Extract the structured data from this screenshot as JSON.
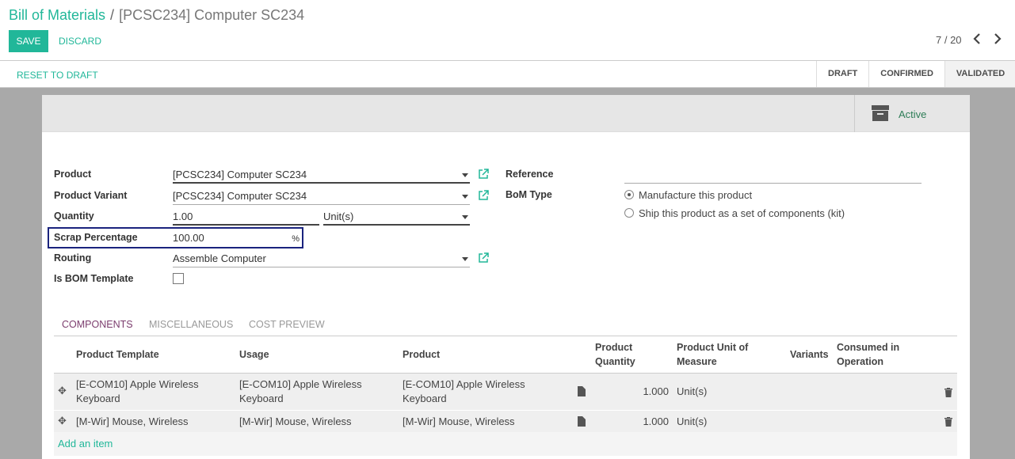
{
  "breadcrumb": {
    "parent": "Bill of Materials",
    "separator": "/",
    "current": "[PCSC234] Computer SC234"
  },
  "buttons": {
    "save": "SAVE",
    "discard": "DISCARD"
  },
  "pager": {
    "value": "7 / 20",
    "prev": "‹",
    "next": "›"
  },
  "statusbar": {
    "reset": "RESET TO DRAFT",
    "stages": [
      "DRAFT",
      "CONFIRMED",
      "VALIDATED"
    ],
    "current_stage": "VALIDATED"
  },
  "active_button": {
    "label": "Active",
    "icon": "archive-icon"
  },
  "form": {
    "product_label": "Product",
    "product_value": "[PCSC234] Computer SC234",
    "variant_label": "Product Variant",
    "variant_value": "[PCSC234] Computer SC234",
    "quantity_label": "Quantity",
    "quantity_value": "1.00",
    "uom_value": "Unit(s)",
    "scrap_label": "Scrap Percentage",
    "scrap_value": "100.00",
    "scrap_unit": "%",
    "routing_label": "Routing",
    "routing_value": "Assemble Computer",
    "template_label": "Is BOM Template",
    "reference_label": "Reference",
    "reference_value": "",
    "bom_type_label": "BoM Type",
    "bom_type_options": [
      "Manufacture this product",
      "Ship this product as a set of components (kit)"
    ],
    "bom_type_selected": "Manufacture this product"
  },
  "tabs": [
    "COMPONENTS",
    "MISCELLANEOUS",
    "COST PREVIEW"
  ],
  "active_tab": "COMPONENTS",
  "table": {
    "headers": {
      "product_template": "Product Template",
      "usage": "Usage",
      "product": "Product",
      "product_quantity": "Product Quantity",
      "uom": "Product Unit of Measure",
      "variants": "Variants",
      "consumed": "Consumed in Operation"
    },
    "rows": [
      {
        "product_template": "[E-COM10] Apple Wireless Keyboard",
        "usage": "[E-COM10] Apple Wireless Keyboard",
        "product": "[E-COM10] Apple Wireless Keyboard",
        "quantity": "1.000",
        "uom": "Unit(s)",
        "variants": "",
        "consumed": ""
      },
      {
        "product_template": "[M-Wir] Mouse, Wireless",
        "usage": "[M-Wir] Mouse, Wireless",
        "product": "[M-Wir] Mouse, Wireless",
        "quantity": "1.000",
        "uom": "Unit(s)",
        "variants": "",
        "consumed": ""
      }
    ],
    "add_item": "Add an item"
  },
  "colors": {
    "accent": "#21b799",
    "tab_active": "#7c3d6e",
    "highlight_border": "#1a237e"
  }
}
